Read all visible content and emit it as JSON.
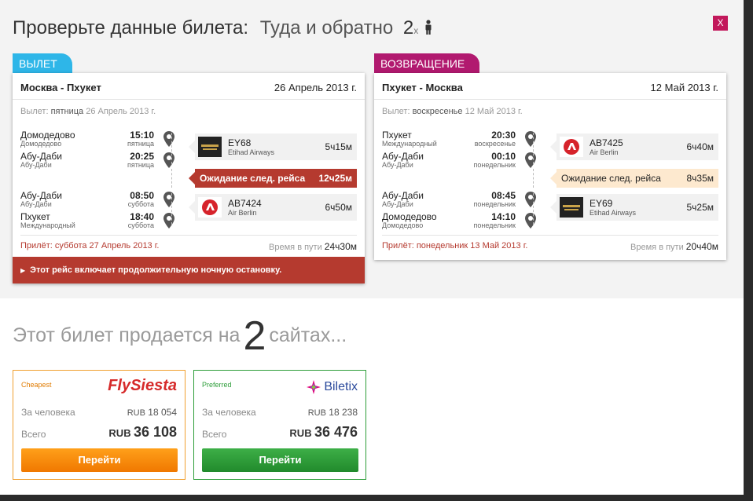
{
  "header": {
    "title": "Проверьте данные билета:",
    "trip_type": "Туда и обратно",
    "passengers": "2",
    "passengers_suffix": "x",
    "close_label": "X"
  },
  "outbound": {
    "tab_label": "ВЫЛЕТ",
    "route": "Москва - Пхукет",
    "date": "26 Апрель 2013 г.",
    "departure_prefix": "Вылет:",
    "departure_day": "пятница",
    "departure_date": "26 Апрель 2013 г.",
    "stops": [
      {
        "city": "Домодедово",
        "airport": "Домодедово",
        "time": "15:10",
        "day": "пятница"
      },
      {
        "city": "Абу-Даби",
        "airport": "Абу-Даби",
        "time": "20:25",
        "day": "пятница"
      },
      {
        "city": "Абу-Даби",
        "airport": "Абу-Даби",
        "time": "08:50",
        "day": "суббота"
      },
      {
        "city": "Пхукет",
        "airport": "Международный",
        "time": "18:40",
        "day": "суббота"
      }
    ],
    "flights": [
      {
        "number": "EY68",
        "airline": "Etihad Airways",
        "duration": "5ч15м",
        "logo": "etihad-logo"
      },
      {
        "number": "AB7424",
        "airline": "Air Berlin",
        "duration": "6ч50м",
        "logo": "airberlin-logo"
      }
    ],
    "layover": {
      "label": "Ожидание след. рейса",
      "duration": "12ч25м"
    },
    "arrival": "Прилёт: суббота 27 Апрель 2013 г.",
    "travel_label": "Время в пути",
    "travel_time": "24ч30м",
    "notice": "Этот рейс включает продолжительную ночную остановку."
  },
  "return": {
    "tab_label": "ВОЗВРАЩЕНИЕ",
    "route": "Пхукет - Москва",
    "date": "12 Май 2013 г.",
    "departure_prefix": "Вылет:",
    "departure_day": "воскресенье",
    "departure_date": "12 Май 2013 г.",
    "stops": [
      {
        "city": "Пхукет",
        "airport": "Международный",
        "time": "20:30",
        "day": "воскресенье"
      },
      {
        "city": "Абу-Даби",
        "airport": "Абу-Даби",
        "time": "00:10",
        "day": "понедельник"
      },
      {
        "city": "Абу-Даби",
        "airport": "Абу-Даби",
        "time": "08:45",
        "day": "понедельник"
      },
      {
        "city": "Домодедово",
        "airport": "Домодедово",
        "time": "14:10",
        "day": "понедельник"
      }
    ],
    "flights": [
      {
        "number": "AB7425",
        "airline": "Air Berlin",
        "duration": "6ч40м",
        "logo": "airberlin-logo"
      },
      {
        "number": "EY69",
        "airline": "Etihad Airways",
        "duration": "5ч25м",
        "logo": "etihad-logo"
      }
    ],
    "layover": {
      "label": "Ожидание след. рейса",
      "duration": "8ч35м"
    },
    "arrival": "Прилёт: понедельник 13 Май 2013 г.",
    "travel_label": "Время в пути",
    "travel_time": "20ч40м"
  },
  "sold": {
    "prefix": "Этот билет продается на",
    "count": "2",
    "suffix": "сайтах..."
  },
  "vendors": [
    {
      "tag": "Cheapest",
      "name": "FlySiesta",
      "per_person_label": "За человека",
      "currency": "RUB",
      "per_person": "18 054",
      "total_label": "Всего",
      "total": "36 108",
      "button": "Перейти"
    },
    {
      "tag": "Preferred",
      "name": "Biletix",
      "per_person_label": "За человека",
      "currency": "RUB",
      "per_person": "18 238",
      "total_label": "Всего",
      "total": "36 476",
      "button": "Перейти"
    }
  ],
  "colors": {
    "brand": "#c2185b",
    "outbound_tab": "#2eb6e8",
    "return_tab": "#b1196f",
    "alert": "#b53a2f",
    "cheapest": "#f07800",
    "preferred": "#2e9e3a"
  }
}
